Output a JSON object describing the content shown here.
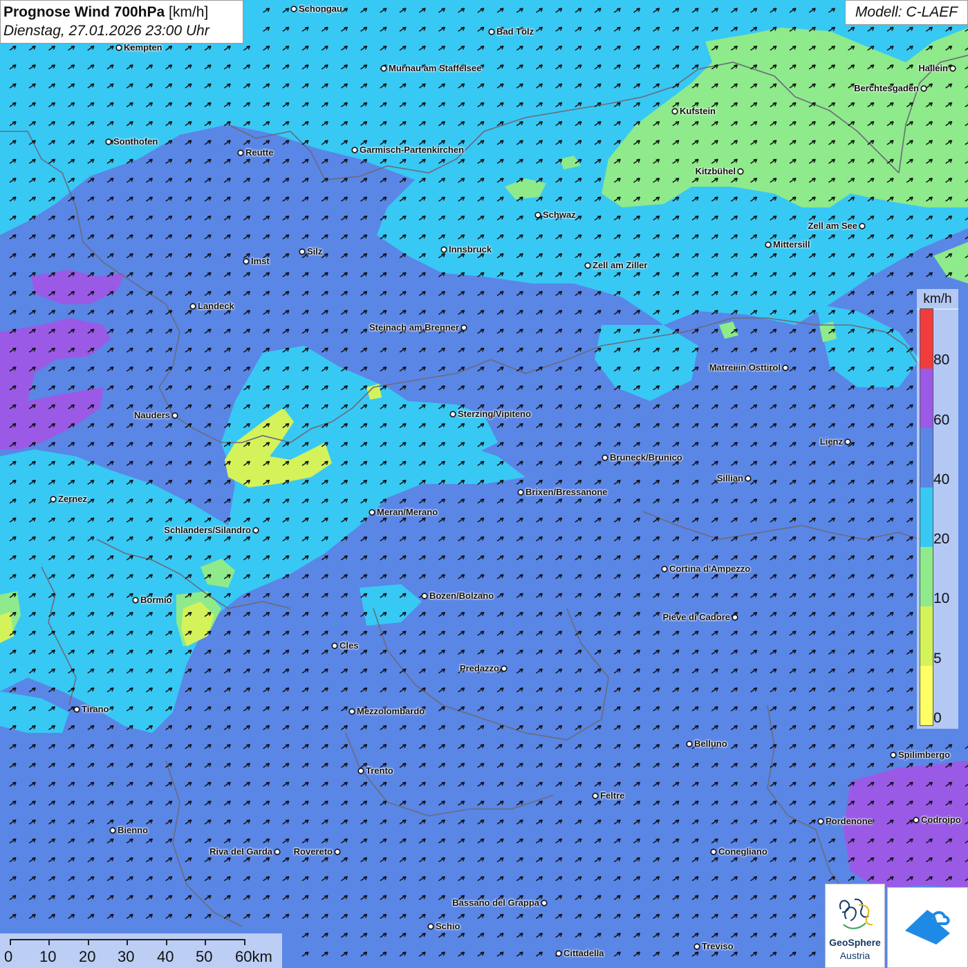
{
  "title": {
    "main_bold": "Prognose Wind 700hPa",
    "main_unit": " [km/h]",
    "datetime": "Dienstag, 27.01.2026 23:00 Uhr"
  },
  "model_label": "Modell: C-LAEF",
  "colors": {
    "speed_0_5": "#ffff66",
    "speed_5_10": "#d4f25a",
    "speed_10_20": "#8eea8a",
    "speed_20_40": "#38c8f4",
    "speed_40_60": "#5a86e6",
    "speed_60_80": "#9a5ae6",
    "speed_80_plus": "#f03c3c",
    "borders": "#6b6b7a",
    "arrows": "#111111"
  },
  "legend": {
    "unit": "km/h",
    "ticks": [
      "80",
      "60",
      "40",
      "20",
      "10",
      "5",
      "0"
    ]
  },
  "scale_bar": {
    "labels": [
      "0",
      "10",
      "20",
      "30",
      "40",
      "50",
      "60km"
    ]
  },
  "logos": [
    {
      "name": "geosphere-logo",
      "line1": "GeoSphere",
      "line2": "Austria"
    },
    {
      "name": "partner-logo-icon"
    }
  ],
  "cities": [
    {
      "name": "Schongau"
    },
    {
      "name": "Bad Tölz"
    },
    {
      "name": "Kempten"
    },
    {
      "name": "Murnau am Staffelsee"
    },
    {
      "name": "Hallein"
    },
    {
      "name": "Berchtesgaden"
    },
    {
      "name": "Kufstein"
    },
    {
      "name": "Sonthofen"
    },
    {
      "name": "Reutte"
    },
    {
      "name": "Garmisch-Partenkirchen"
    },
    {
      "name": "Kitzbühel"
    },
    {
      "name": "Schwaz"
    },
    {
      "name": "Zell am See"
    },
    {
      "name": "Mittersill"
    },
    {
      "name": "Innsbruck"
    },
    {
      "name": "Silz"
    },
    {
      "name": "Imst"
    },
    {
      "name": "Zell am Ziller"
    },
    {
      "name": "Landeck"
    },
    {
      "name": "Steinach am Brenner"
    },
    {
      "name": "Matrei in Osttirol"
    },
    {
      "name": "Nauders"
    },
    {
      "name": "Sterzing/Vipiteno"
    },
    {
      "name": "Lienz"
    },
    {
      "name": "Bruneck/Brunico"
    },
    {
      "name": "Sillian"
    },
    {
      "name": "Brixen/Bressanone"
    },
    {
      "name": "Zernez"
    },
    {
      "name": "Meran/Merano"
    },
    {
      "name": "Schlanders/Silandro"
    },
    {
      "name": "Cortina d'Ampezzo"
    },
    {
      "name": "Bozen/Bolzano"
    },
    {
      "name": "Bormio"
    },
    {
      "name": "Pieve di Cadore"
    },
    {
      "name": "Cles"
    },
    {
      "name": "Predazzo"
    },
    {
      "name": "Tirano"
    },
    {
      "name": "Mezzolombardo"
    },
    {
      "name": "Belluno"
    },
    {
      "name": "Spilimbergo"
    },
    {
      "name": "Trento"
    },
    {
      "name": "Feltre"
    },
    {
      "name": "Pordenone"
    },
    {
      "name": "Codroipo"
    },
    {
      "name": "Bienno"
    },
    {
      "name": "Riva del Garda"
    },
    {
      "name": "Rovereto"
    },
    {
      "name": "Conegliano"
    },
    {
      "name": "Bassano del Grappa"
    },
    {
      "name": "Schio"
    },
    {
      "name": "Treviso"
    },
    {
      "name": "Cittadella"
    }
  ]
}
